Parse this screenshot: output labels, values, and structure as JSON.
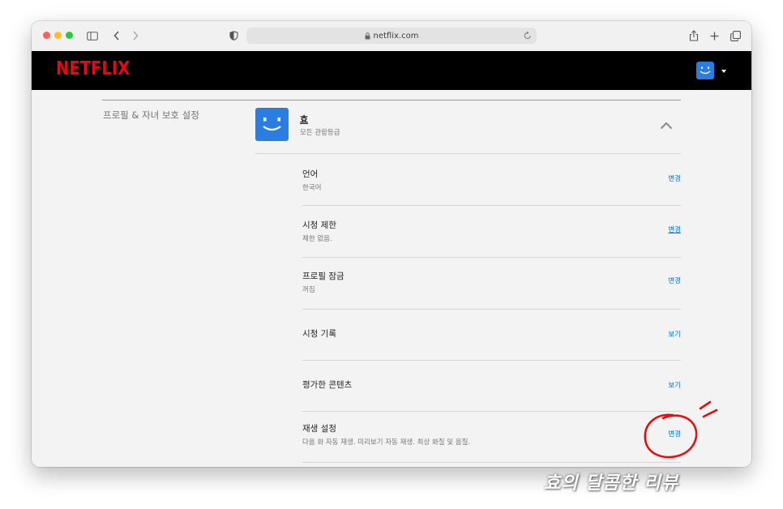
{
  "browser": {
    "url": "netflix.com",
    "traffic_lights": {
      "red": "#ff5f57",
      "yellow": "#febc2e",
      "green": "#28c840"
    },
    "icons": [
      "sidebar-toggle-icon",
      "back-icon",
      "forward-icon",
      "shield-icon",
      "lock-icon",
      "reload-icon",
      "share-icon",
      "new-tab-icon",
      "tab-overview-icon"
    ]
  },
  "header": {
    "logo": "NETFLIX",
    "logo_color": "#e50914",
    "avatar_color": "#2a7de1"
  },
  "section": {
    "label": "프로필 & 자녀 보호 설정"
  },
  "profile": {
    "name": "효",
    "rating": "모든 관람등급",
    "avatar_color": "#2a7de1"
  },
  "settings": [
    {
      "title": "언어",
      "subtitle": "한국어",
      "action": "변경"
    },
    {
      "title": "시청 제한",
      "subtitle": "제한 없음.",
      "action": "변경"
    },
    {
      "title": "프로필 잠금",
      "subtitle": "꺼짐",
      "action": "변경"
    },
    {
      "title": "시청 기록",
      "subtitle": "",
      "action": "보기"
    },
    {
      "title": "평가한 콘텐츠",
      "subtitle": "",
      "action": "보기"
    },
    {
      "title": "재생 설정",
      "subtitle": "다음 화 자동 재생. 미리보기 자동 재생. 최상 화질 및 음질.",
      "action": "변경"
    }
  ],
  "watermark": "효의 달콤한 리뷰",
  "annotation_color": "#e01010",
  "link_color": "#0071eb"
}
